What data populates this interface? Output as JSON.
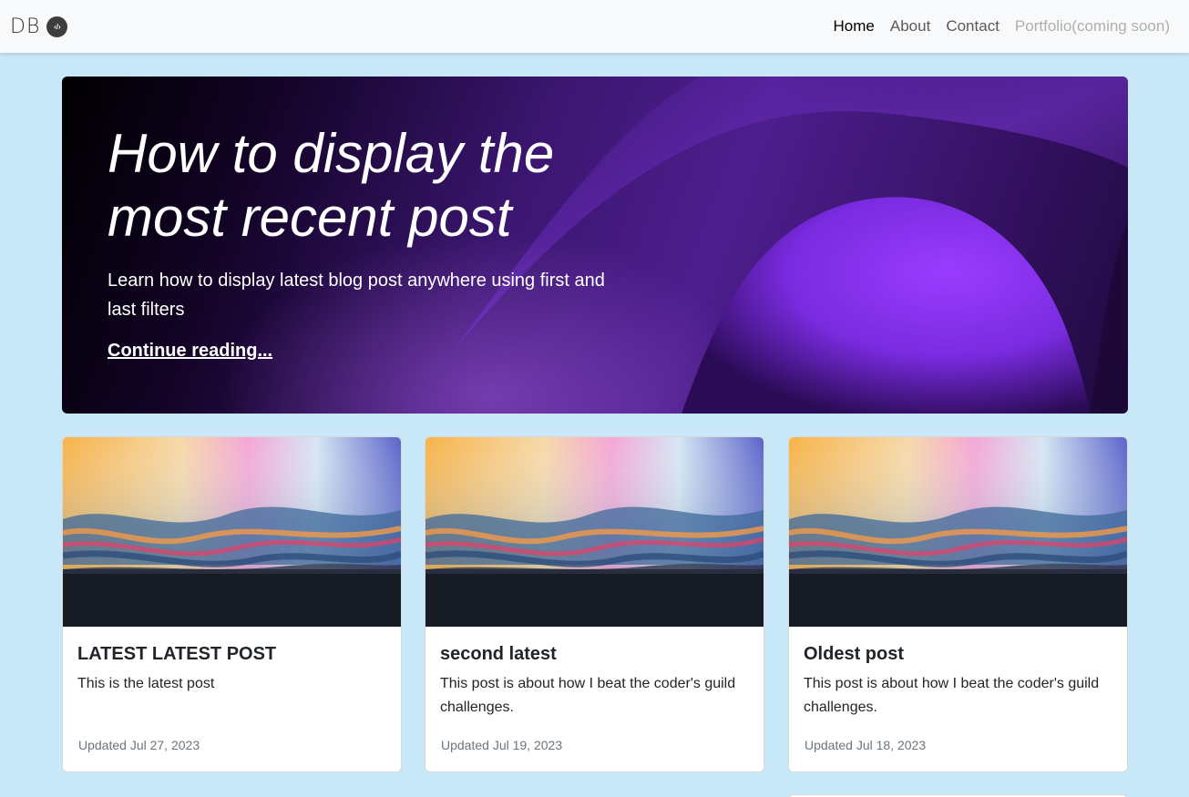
{
  "navbar": {
    "brand_text": "DB",
    "brand_badge_glyph": "‹/›",
    "links": [
      {
        "label": "Home",
        "state": "active"
      },
      {
        "label": "About",
        "state": "normal"
      },
      {
        "label": "Contact",
        "state": "normal"
      },
      {
        "label": "Portfolio(coming soon)",
        "state": "disabled"
      }
    ]
  },
  "hero": {
    "title": "How to display the most recent post",
    "lead": "Learn how to display latest blog post anywhere using first and last filters",
    "link_label": "Continue reading..."
  },
  "posts": [
    {
      "title": "LATEST LATEST POST",
      "excerpt": "This is the latest post",
      "updated": "Updated Jul 27, 2023"
    },
    {
      "title": "second latest",
      "excerpt": "This post is about how I beat the coder's guild challenges.",
      "updated": "Updated Jul 19, 2023"
    },
    {
      "title": "Oldest post",
      "excerpt": "This post is about how I beat the coder's guild challenges.",
      "updated": "Updated Jul 18, 2023"
    }
  ],
  "colors": {
    "page_background": "#c8e8f8",
    "navbar_background": "#f8f9fa",
    "hero_accent": "#8a3ff5",
    "muted_text": "#6c757d"
  }
}
